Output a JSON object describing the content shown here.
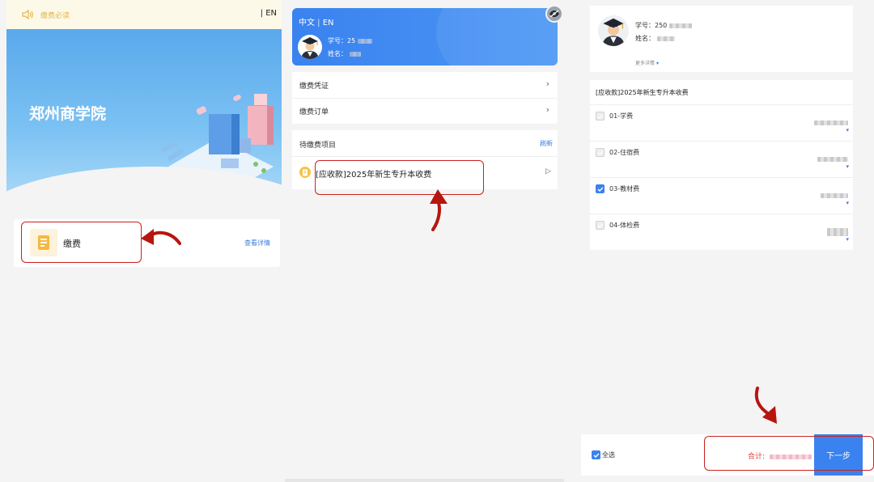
{
  "panel1": {
    "notice_text": "缴费必读",
    "lang": "| EN",
    "school_name": "郑州商学院",
    "card_label": "缴费",
    "card_more": "查看详情"
  },
  "panel2": {
    "lang_zh": "中文",
    "lang_sep": " | ",
    "lang_en": "EN",
    "student_no_label": "学号：",
    "student_no_value": "25",
    "name_label": "姓名：",
    "menu": [
      {
        "label": "缴费凭证"
      },
      {
        "label": "缴费订单"
      }
    ],
    "pending_title": "待缴费项目",
    "refresh": "刷新",
    "pending_item": "[应收款]2025年新生专升本收费"
  },
  "panel3": {
    "student_no_label": "学号：",
    "student_no_value": "250",
    "name_label": "姓名：",
    "more_details": "更多详情",
    "bill_title": "[应收款]2025年新生专升本收费",
    "fees": [
      {
        "name": "01-学费",
        "checked": false
      },
      {
        "name": "02-住宿费",
        "checked": false
      },
      {
        "name": "03-教材费",
        "checked": true
      },
      {
        "name": "04-体检费",
        "checked": false
      }
    ],
    "select_all": "全选",
    "total_label": "合计:",
    "next_button": "下一步"
  },
  "colors": {
    "accent": "#3a82ef",
    "highlight": "#c9211e",
    "total_red": "#e23c3c",
    "notice_bg": "#fdf9e8"
  }
}
